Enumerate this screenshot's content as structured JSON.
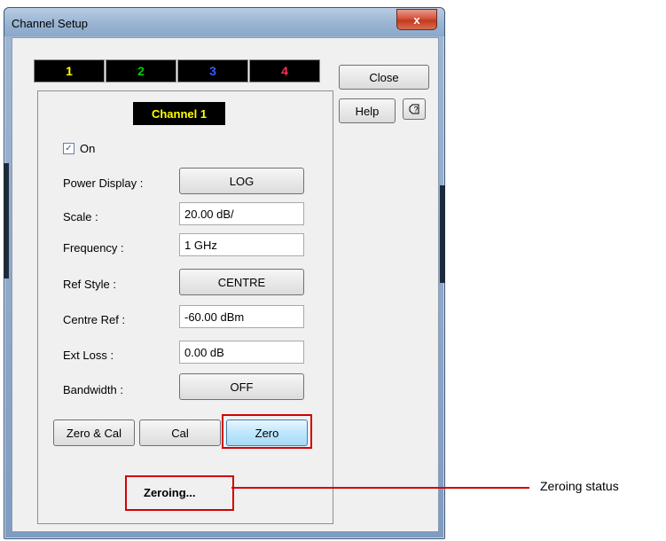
{
  "window": {
    "title": "Channel Setup",
    "close_glyph": "x"
  },
  "channel_tabs": [
    {
      "label": "1",
      "color": "#ffff00"
    },
    {
      "label": "2",
      "color": "#00d000"
    },
    {
      "label": "3",
      "color": "#3a5cff"
    },
    {
      "label": "4",
      "color": "#ff2d55"
    }
  ],
  "side_buttons": {
    "close": "Close",
    "help": "Help",
    "whats_this_icon": "context-help-icon"
  },
  "panel": {
    "channel_title": "Channel 1",
    "on_checkbox": {
      "label": "On",
      "checked": true
    },
    "power_display": {
      "label": "Power Display :",
      "value": "LOG"
    },
    "scale": {
      "label": "Scale :",
      "value": "20.00 dB/"
    },
    "frequency": {
      "label": "Frequency :",
      "value": "1 GHz"
    },
    "ref_style": {
      "label": "Ref Style :",
      "value": "CENTRE"
    },
    "centre_ref": {
      "label": "Centre Ref :",
      "value": "-60.00 dBm"
    },
    "ext_loss": {
      "label": "Ext Loss :",
      "value": "0.00 dB"
    },
    "bandwidth": {
      "label": "Bandwidth :",
      "value": "OFF"
    },
    "buttons": {
      "zero_cal": "Zero & Cal",
      "cal": "Cal",
      "zero": "Zero"
    },
    "status_text": "Zeroing..."
  },
  "callout": {
    "label": "Zeroing status",
    "color": "#d40000"
  }
}
